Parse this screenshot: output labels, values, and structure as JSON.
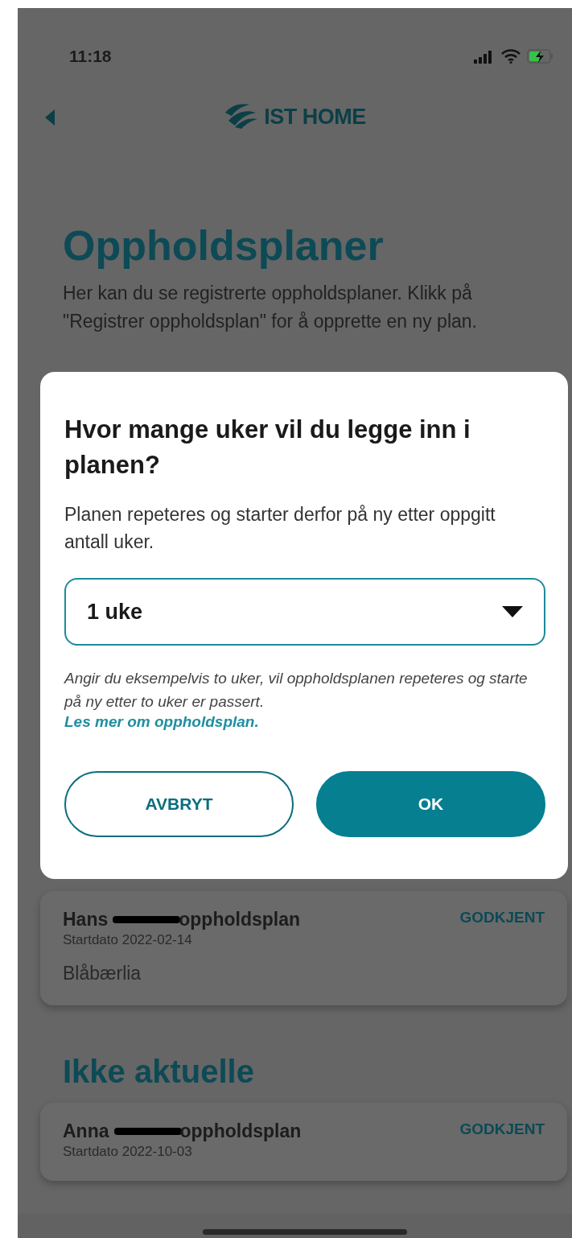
{
  "status_bar": {
    "time": "11:18"
  },
  "nav": {
    "logo_text": "IST HOME"
  },
  "page": {
    "title": "Oppholdsplaner",
    "description": "Her kan du se registrerte oppholdsplaner. Klikk på \"Registrer oppholdsplan\" for å opprette en ny plan."
  },
  "plans": [
    {
      "name_start": "Hans",
      "name_end": "oppholdsplan",
      "redacted": true,
      "start_date": "Startdato 2022-02-14",
      "place": "Blåbærlia",
      "status": "GODKJENT"
    }
  ],
  "inactive": {
    "title": "Ikke aktuelle",
    "plans": [
      {
        "name_start": "Anna",
        "name_end": "oppholdsplan",
        "redacted": true,
        "start_date": "Startdato 2022-10-03",
        "status": "GODKJENT"
      }
    ]
  },
  "dialog": {
    "title": "Hvor mange uker vil du legge inn i planen?",
    "text": "Planen repeteres og starter derfor på ny etter oppgitt antall uker.",
    "select": {
      "value": "1 uke"
    },
    "hint": "Angir du eksempelvis to uker, vil oppholdsplanen repeteres og starte på ny etter to uker er passert.",
    "link": "Les mer om oppholdsplan.",
    "buttons": [
      {
        "label": "AVBRYT",
        "kind": "outline"
      },
      {
        "label": "OK",
        "kind": "primary"
      }
    ]
  }
}
